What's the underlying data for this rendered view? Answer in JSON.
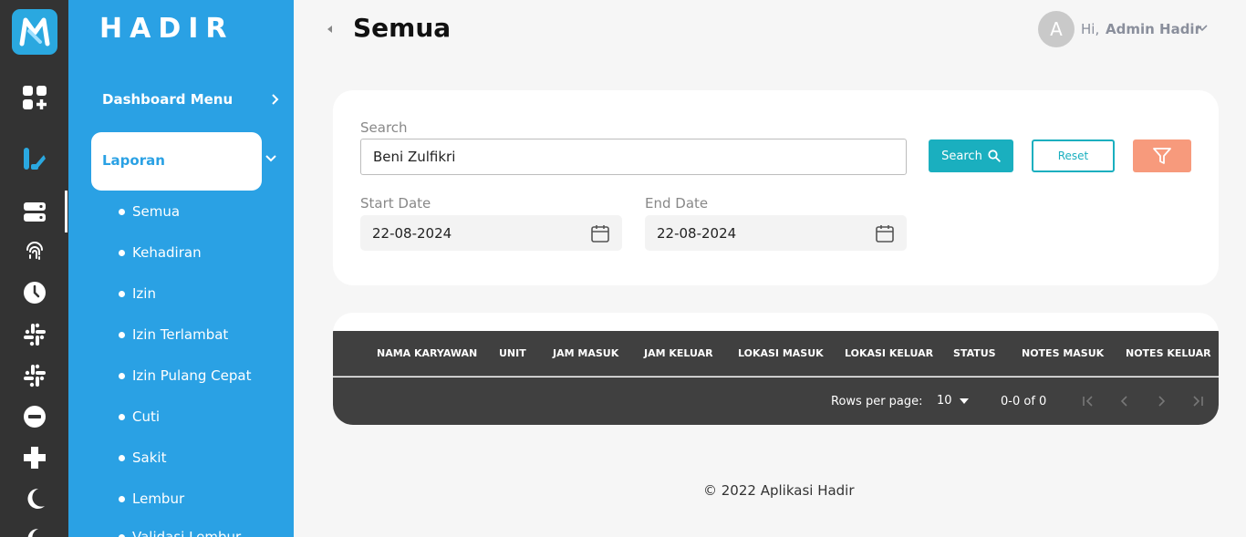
{
  "sidebar": {
    "brand": "HADIR",
    "dashboard_menu": "Dashboard Menu",
    "laporan": "Laporan",
    "sub_items": [
      "Semua",
      "Kehadiran",
      "Izin",
      "Izin Terlambat",
      "Izin Pulang Cepat",
      "Cuti",
      "Sakit",
      "Lembur",
      "Validasi Lembur"
    ]
  },
  "header": {
    "title": "Semua",
    "avatar_letter": "A",
    "greeting": "Hi,",
    "user_name": "Admin Hadir"
  },
  "filter": {
    "search_label": "Search",
    "search_value": "Beni Zulfikri",
    "search_button": "Search",
    "reset_button": "Reset",
    "start_date_label": "Start Date",
    "start_date_value": "22-08-2024",
    "end_date_label": "End Date",
    "end_date_value": "22-08-2024"
  },
  "table": {
    "columns": [
      "NAMA KARYAWAN",
      "UNIT",
      "JAM MASUK",
      "JAM KELUAR",
      "LOKASI MASUK",
      "LOKASI KELUAR",
      "STATUS",
      "NOTES MASUK",
      "NOTES KELUAR"
    ],
    "rows_per_page_label": "Rows per page:",
    "rows_per_page_value": "10",
    "range_text": "0-0 of 0"
  },
  "footer": {
    "text": "© 2022 Aplikasi Hadir"
  },
  "colors": {
    "rail": "#333333",
    "sidebar": "#2aa1e4",
    "accent": "#1aafbf",
    "filter_button": "#f79a7c",
    "table_dark": "#404040"
  },
  "icons": {
    "rail": [
      "app-logo-icon",
      "dashboard-grid-icon",
      "report-icon",
      "server-icon",
      "fingerprint-icon",
      "clock-icon",
      "slack-icon",
      "slack-icon",
      "minus-circle-icon",
      "plus-icon",
      "moon-icon",
      "moon-icon"
    ]
  }
}
